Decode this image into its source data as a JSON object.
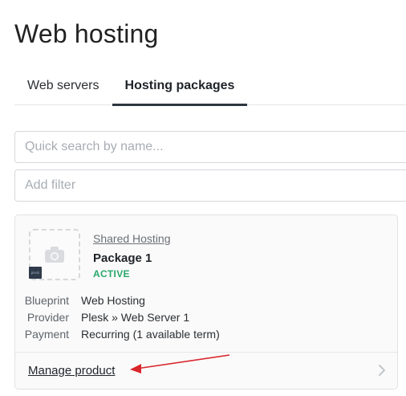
{
  "page": {
    "title": "Web hosting"
  },
  "tabs": [
    {
      "label": "Web servers",
      "active": false
    },
    {
      "label": "Hosting packages",
      "active": true
    }
  ],
  "search": {
    "placeholder": "Quick search by name..."
  },
  "filter": {
    "placeholder": "Add filter"
  },
  "card": {
    "category": "Shared Hosting",
    "name": "Package 1",
    "status": "ACTIVE",
    "status_color": "#28a86b",
    "thumbnail_icon": "camera-icon",
    "badge_text": "plesk",
    "details": [
      {
        "label": "Blueprint",
        "value": "Web Hosting"
      },
      {
        "label": "Provider",
        "value": "Plesk » Web Server 1"
      },
      {
        "label": "Payment",
        "value": "Recurring (1 available term)"
      }
    ],
    "footer": {
      "link_label": "Manage product",
      "chevron_icon": "chevron-right-icon"
    }
  },
  "annotation": {
    "arrow_color": "#d9262c",
    "icon": "red-arrow-icon"
  }
}
